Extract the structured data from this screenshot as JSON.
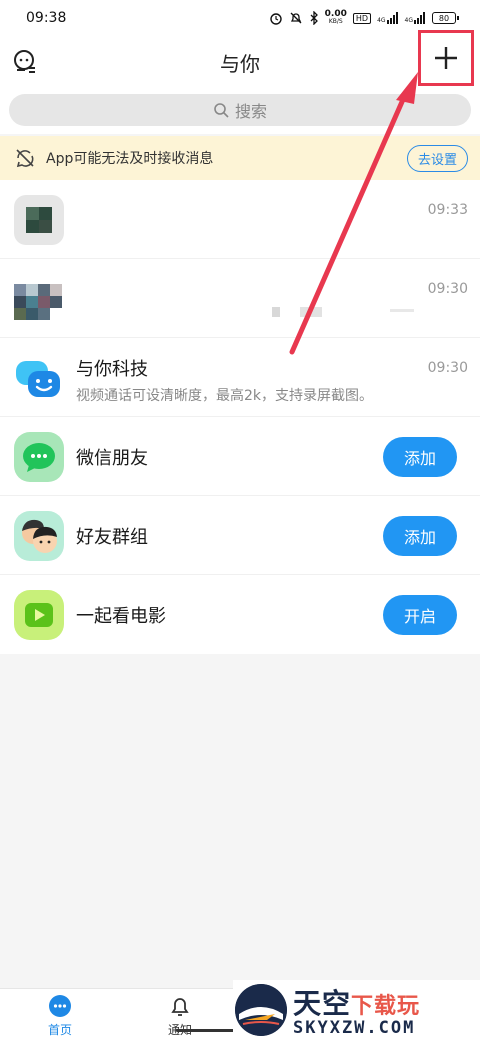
{
  "status_bar": {
    "time": "09:38",
    "net_speed_top": "0.00",
    "net_speed_unit": "KB/S",
    "hd_badge": "HD",
    "signal1": "4G",
    "signal2": "4G",
    "battery": "80"
  },
  "header": {
    "title": "与你"
  },
  "search": {
    "placeholder": "搜索"
  },
  "notice": {
    "text": "App可能无法及时接收消息",
    "button": "去设置"
  },
  "conversations": [
    {
      "name": "",
      "time": "09:33"
    },
    {
      "name": "",
      "time": "09:30"
    },
    {
      "name": "与你科技",
      "subtitle": "视频通话可设清晰度，最高2k，支持录屏截图。",
      "time": "09:30"
    }
  ],
  "features": [
    {
      "name": "微信朋友",
      "button": "添加"
    },
    {
      "name": "好友群组",
      "button": "添加"
    },
    {
      "name": "一起看电影",
      "button": "开启"
    }
  ],
  "tabs": [
    {
      "label": "首页"
    },
    {
      "label": "通知"
    }
  ],
  "watermark": {
    "top_main": "天空",
    "top_accent": "下载玩",
    "bottom": "SKYXZW.COM"
  },
  "colors": {
    "accent_blue": "#2196f3",
    "arrow_red": "#e8384f",
    "notice_bg": "#fdf4d6"
  }
}
